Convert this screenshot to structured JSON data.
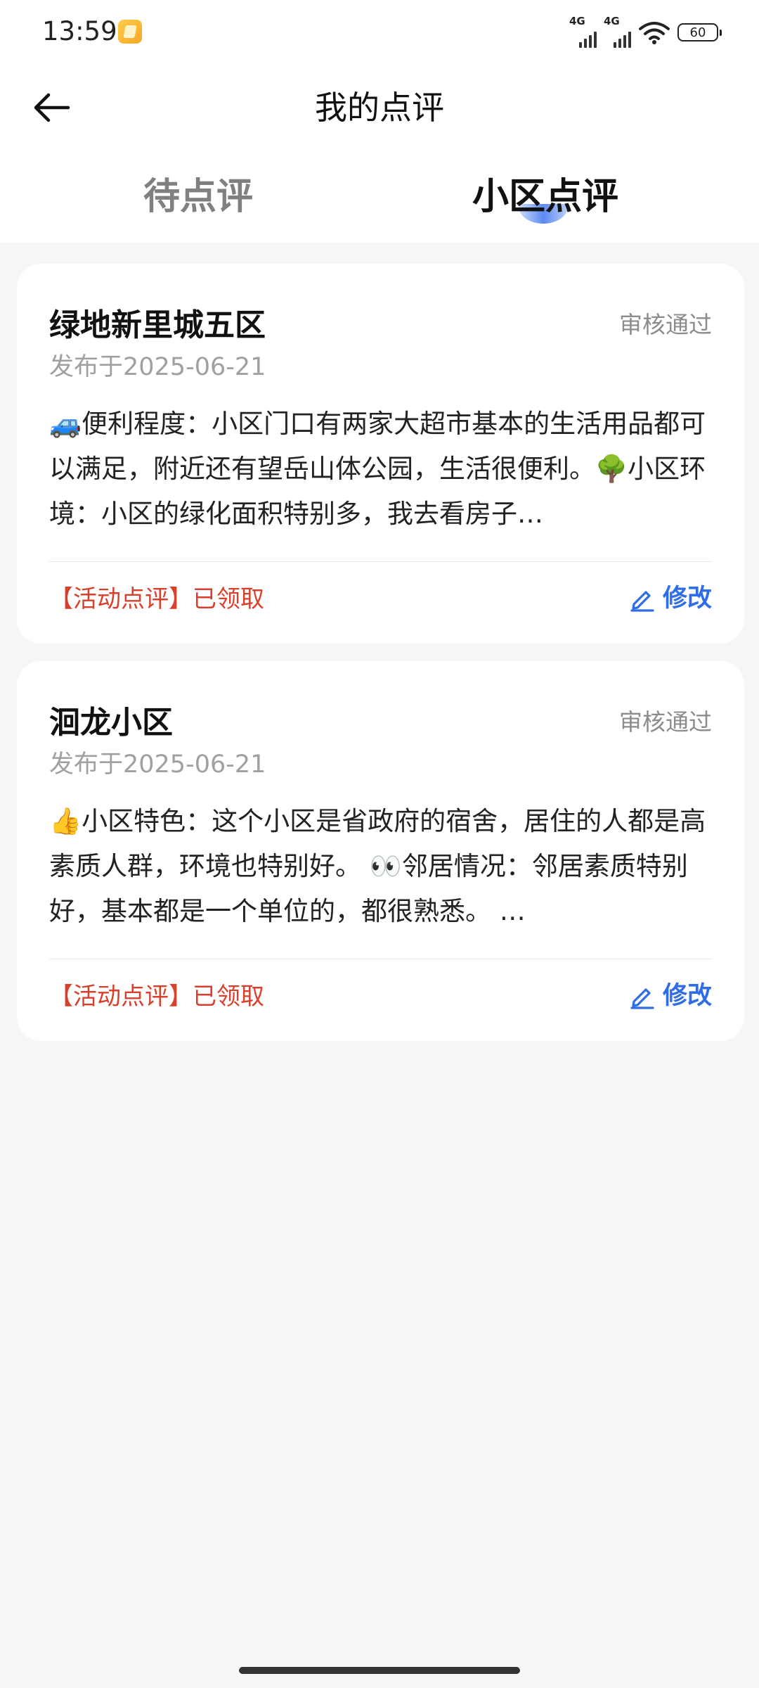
{
  "status_bar": {
    "time": "13:59",
    "signal1_label": "4G",
    "signal2_label": "4G",
    "battery": "60",
    "icons": [
      "app-notification-icon",
      "signal-icon",
      "signal-icon",
      "wifi-icon",
      "battery-icon"
    ]
  },
  "nav": {
    "title": "我的点评",
    "back_icon": "back-arrow-icon"
  },
  "tabs": [
    {
      "label": "待点评",
      "selected": false
    },
    {
      "label": "小区点评",
      "selected": true
    }
  ],
  "colors": {
    "accent": "#2f6de6",
    "activity_red": "#d8402b",
    "status_gray": "#8c8c8c",
    "background": "#f6f6f6"
  },
  "reviews": [
    {
      "title": "绿地新里城五区",
      "status": "审核通过",
      "date": "发布于2025-06-21",
      "content": "🚙便利程度：小区门口有两家大超市基本的生活用品都可以满足，附近还有望岳山体公园，生活很便利。🌳小区环境：小区的绿化面积特别多，我去看房子…",
      "activity": "【活动点评】已领取",
      "edit_label": "修改"
    },
    {
      "title": "洄龙小区",
      "status": "审核通过",
      "date": "发布于2025-06-21",
      "content": "👍小区特色：这个小区是省政府的宿舍，居住的人都是高素质人群，环境也特别好。 👀邻居情况：邻居素质特别好，基本都是一个单位的，都很熟悉。 …",
      "activity": "【活动点评】已领取",
      "edit_label": "修改"
    }
  ]
}
